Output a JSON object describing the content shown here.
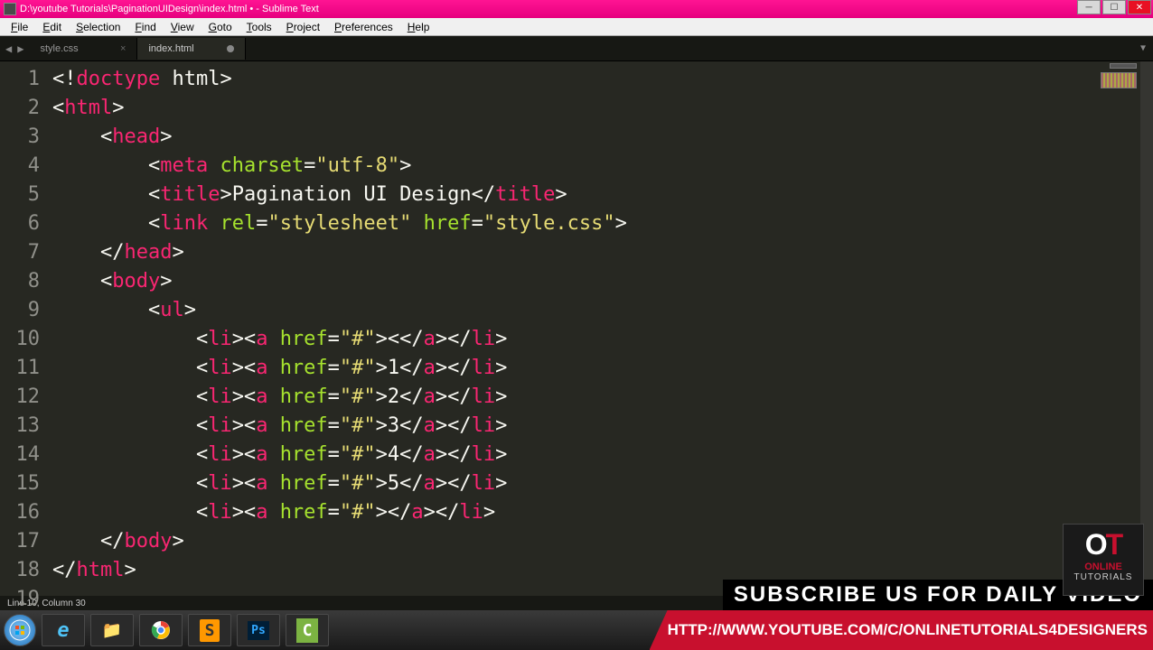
{
  "window": {
    "title": "D:\\youtube Tutorials\\PaginationUIDesign\\index.html • - Sublime Text"
  },
  "menu": {
    "items": [
      "File",
      "Edit",
      "Selection",
      "Find",
      "View",
      "Goto",
      "Tools",
      "Project",
      "Preferences",
      "Help"
    ]
  },
  "tabs": [
    {
      "label": "style.css",
      "active": false,
      "dirty": false
    },
    {
      "label": "index.html",
      "active": true,
      "dirty": true
    }
  ],
  "status": {
    "text": "Line 10, Column 30"
  },
  "code": {
    "cursor_line": 10,
    "lines": [
      {
        "n": 1,
        "tokens": [
          [
            "<!",
            "w"
          ],
          [
            "doctype",
            "p"
          ],
          [
            " html>",
            "w"
          ]
        ]
      },
      {
        "n": 2,
        "tokens": [
          [
            "<",
            "w"
          ],
          [
            "html",
            "p"
          ],
          [
            ">",
            "w"
          ]
        ]
      },
      {
        "n": 3,
        "tokens": [
          [
            "    <",
            "w"
          ],
          [
            "head",
            "p"
          ],
          [
            ">",
            "w"
          ]
        ]
      },
      {
        "n": 4,
        "tokens": [
          [
            "        <",
            "w"
          ],
          [
            "meta",
            "p"
          ],
          [
            " ",
            "w"
          ],
          [
            "charset",
            "a"
          ],
          [
            "=",
            "w"
          ],
          [
            "\"utf-8\"",
            "s"
          ],
          [
            ">",
            "w"
          ]
        ]
      },
      {
        "n": 5,
        "tokens": [
          [
            "        <",
            "w"
          ],
          [
            "title",
            "p"
          ],
          [
            ">Pagination UI Design</",
            "w"
          ],
          [
            "title",
            "p"
          ],
          [
            ">",
            "w"
          ]
        ]
      },
      {
        "n": 6,
        "tokens": [
          [
            "        <",
            "w"
          ],
          [
            "link",
            "p"
          ],
          [
            " ",
            "w"
          ],
          [
            "rel",
            "a"
          ],
          [
            "=",
            "w"
          ],
          [
            "\"stylesheet\"",
            "s"
          ],
          [
            " ",
            "w"
          ],
          [
            "href",
            "a"
          ],
          [
            "=",
            "w"
          ],
          [
            "\"style.css\"",
            "s"
          ],
          [
            ">",
            "w"
          ]
        ]
      },
      {
        "n": 7,
        "tokens": [
          [
            "    </",
            "w"
          ],
          [
            "head",
            "p"
          ],
          [
            ">",
            "w"
          ]
        ]
      },
      {
        "n": 8,
        "tokens": [
          [
            "    <",
            "w"
          ],
          [
            "body",
            "p"
          ],
          [
            ">",
            "w"
          ]
        ]
      },
      {
        "n": 9,
        "tokens": [
          [
            "        <",
            "w"
          ],
          [
            "ul",
            "p"
          ],
          [
            ">",
            "w"
          ]
        ]
      },
      {
        "n": 10,
        "tokens": [
          [
            "            <",
            "w"
          ],
          [
            "li",
            "p"
          ],
          [
            "><",
            "w"
          ],
          [
            "a",
            "p"
          ],
          [
            " ",
            "w"
          ],
          [
            "href",
            "a"
          ],
          [
            "=",
            "w"
          ],
          [
            "\"#\"",
            "s"
          ],
          [
            "><</",
            "w"
          ],
          [
            "a",
            "p"
          ],
          [
            "></",
            "w"
          ],
          [
            "li",
            "p"
          ],
          [
            ">",
            "w"
          ]
        ]
      },
      {
        "n": 11,
        "tokens": [
          [
            "            <",
            "w"
          ],
          [
            "li",
            "p"
          ],
          [
            "><",
            "w"
          ],
          [
            "a",
            "p"
          ],
          [
            " ",
            "w"
          ],
          [
            "href",
            "a"
          ],
          [
            "=",
            "w"
          ],
          [
            "\"#\"",
            "s"
          ],
          [
            ">1</",
            "w"
          ],
          [
            "a",
            "p"
          ],
          [
            "></",
            "w"
          ],
          [
            "li",
            "p"
          ],
          [
            ">",
            "w"
          ]
        ]
      },
      {
        "n": 12,
        "tokens": [
          [
            "            <",
            "w"
          ],
          [
            "li",
            "p"
          ],
          [
            "><",
            "w"
          ],
          [
            "a",
            "p"
          ],
          [
            " ",
            "w"
          ],
          [
            "href",
            "a"
          ],
          [
            "=",
            "w"
          ],
          [
            "\"#\"",
            "s"
          ],
          [
            ">2</",
            "w"
          ],
          [
            "a",
            "p"
          ],
          [
            "></",
            "w"
          ],
          [
            "li",
            "p"
          ],
          [
            ">",
            "w"
          ]
        ]
      },
      {
        "n": 13,
        "tokens": [
          [
            "            <",
            "w"
          ],
          [
            "li",
            "p"
          ],
          [
            "><",
            "w"
          ],
          [
            "a",
            "p"
          ],
          [
            " ",
            "w"
          ],
          [
            "href",
            "a"
          ],
          [
            "=",
            "w"
          ],
          [
            "\"#\"",
            "s"
          ],
          [
            ">3</",
            "w"
          ],
          [
            "a",
            "p"
          ],
          [
            "></",
            "w"
          ],
          [
            "li",
            "p"
          ],
          [
            ">",
            "w"
          ]
        ]
      },
      {
        "n": 14,
        "tokens": [
          [
            "            <",
            "w"
          ],
          [
            "li",
            "p"
          ],
          [
            "><",
            "w"
          ],
          [
            "a",
            "p"
          ],
          [
            " ",
            "w"
          ],
          [
            "href",
            "a"
          ],
          [
            "=",
            "w"
          ],
          [
            "\"#\"",
            "s"
          ],
          [
            ">4</",
            "w"
          ],
          [
            "a",
            "p"
          ],
          [
            "></",
            "w"
          ],
          [
            "li",
            "p"
          ],
          [
            ">",
            "w"
          ]
        ]
      },
      {
        "n": 15,
        "tokens": [
          [
            "            <",
            "w"
          ],
          [
            "li",
            "p"
          ],
          [
            "><",
            "w"
          ],
          [
            "a",
            "p"
          ],
          [
            " ",
            "w"
          ],
          [
            "href",
            "a"
          ],
          [
            "=",
            "w"
          ],
          [
            "\"#\"",
            "s"
          ],
          [
            ">5</",
            "w"
          ],
          [
            "a",
            "p"
          ],
          [
            "></",
            "w"
          ],
          [
            "li",
            "p"
          ],
          [
            ">",
            "w"
          ]
        ]
      },
      {
        "n": 16,
        "tokens": [
          [
            "            <",
            "w"
          ],
          [
            "li",
            "p"
          ],
          [
            "><",
            "w"
          ],
          [
            "a",
            "p"
          ],
          [
            " ",
            "w"
          ],
          [
            "href",
            "a"
          ],
          [
            "=",
            "w"
          ],
          [
            "\"#\"",
            "s"
          ],
          [
            "></",
            "w"
          ],
          [
            "a",
            "p"
          ],
          [
            "></",
            "w"
          ],
          [
            "li",
            "p"
          ],
          [
            ">",
            "w"
          ]
        ]
      },
      {
        "n": 17,
        "tokens": [
          [
            "    </",
            "w"
          ],
          [
            "body",
            "p"
          ],
          [
            ">",
            "w"
          ]
        ]
      },
      {
        "n": 18,
        "tokens": [
          [
            "</",
            "w"
          ],
          [
            "html",
            "p"
          ],
          [
            ">",
            "w"
          ]
        ]
      },
      {
        "n": 19,
        "tokens": []
      }
    ]
  },
  "banner": {
    "subscribe": "SUBSCRIBE US FOR DAILY VIDEO",
    "url": "HTTP://WWW.YOUTUBE.COM/C/ONLINETUTORIALS4DESIGNERS"
  },
  "logo": {
    "big": "OT",
    "line1": "ONLINE",
    "line2": "TUTORIALS"
  },
  "taskbar_icons": [
    "start",
    "ie",
    "explorer",
    "chrome",
    "sublime",
    "photoshop",
    "camtasia"
  ]
}
